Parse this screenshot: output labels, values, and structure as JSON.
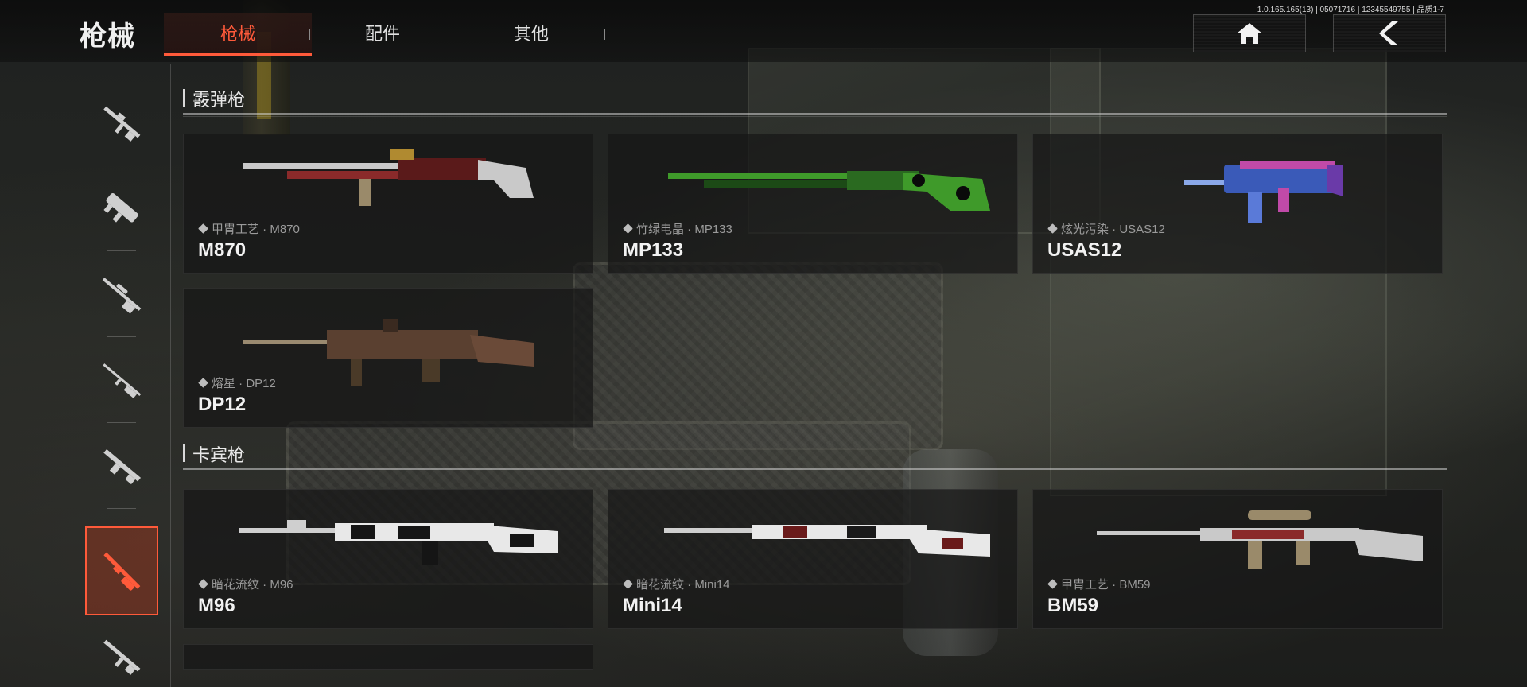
{
  "header": {
    "title": "枪械",
    "tabs": [
      {
        "label": "枪械",
        "active": true
      },
      {
        "label": "配件",
        "active": false
      },
      {
        "label": "其他",
        "active": false
      }
    ],
    "version": "1.0.165.165(13) | 05071716 | 12345549755 | 品质1-7",
    "home_icon": "home-icon",
    "back_icon": "back-arrow-icon"
  },
  "sidebar": {
    "items": [
      {
        "icon": "assault-rifle-icon"
      },
      {
        "icon": "smg-icon"
      },
      {
        "icon": "sniper-rifle-icon"
      },
      {
        "icon": "marksman-rifle-icon"
      },
      {
        "icon": "light-machine-gun-icon"
      },
      {
        "icon": "shotgun-icon",
        "active": true
      },
      {
        "icon": "pistol-rifle-icon"
      }
    ]
  },
  "sections": [
    {
      "label": "霰弹枪",
      "cards": [
        {
          "skin": "甲胄工艺 · M870",
          "name": "M870",
          "colors": [
            "#8a2a2a",
            "#c9c9c9"
          ]
        },
        {
          "skin": "竹绿电晶 · MP133",
          "name": "MP133",
          "colors": [
            "#3f9a2a",
            "#1c4a16"
          ]
        },
        {
          "skin": "炫光污染 · USAS12",
          "name": "USAS12",
          "colors": [
            "#3a5ab8",
            "#c04aa8"
          ]
        },
        {
          "skin": "熔星 · DP12",
          "name": "DP12",
          "colors": [
            "#5a4030",
            "#2a2420"
          ]
        }
      ]
    },
    {
      "label": "卡宾枪",
      "cards": [
        {
          "skin": "暗花流纹 · M96",
          "name": "M96",
          "colors": [
            "#e8e8e8",
            "#151515"
          ]
        },
        {
          "skin": "暗花流纹 · Mini14",
          "name": "Mini14",
          "colors": [
            "#e8e8e8",
            "#6a1a1a"
          ]
        },
        {
          "skin": "甲胄工艺 · BM59",
          "name": "BM59",
          "colors": [
            "#8a2a2a",
            "#c9c9c9"
          ]
        }
      ]
    }
  ],
  "theme": {
    "accent": "#ff5a3a"
  }
}
